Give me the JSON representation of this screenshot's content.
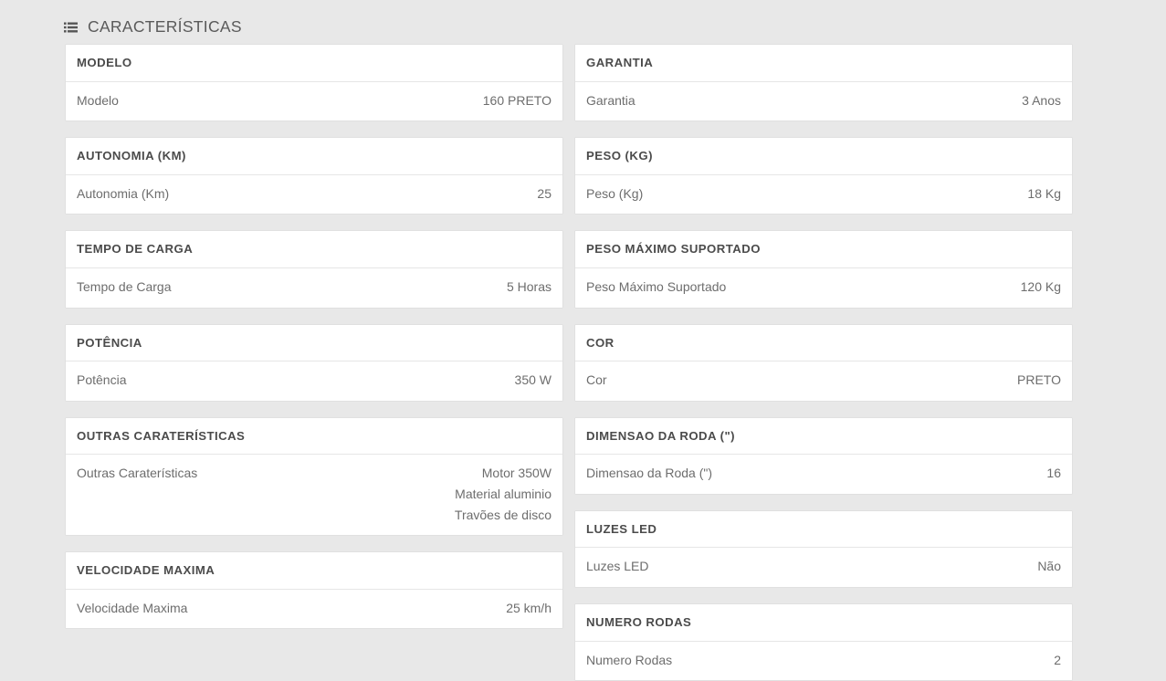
{
  "section": {
    "icon": "list-icon",
    "title": "CARACTERÍSTICAS"
  },
  "columns": {
    "left": [
      {
        "header": "MODELO",
        "label": "Modelo",
        "value": "160 PRETO"
      },
      {
        "header": "AUTONOMIA (KM)",
        "label": "Autonomia (Km)",
        "value": "25"
      },
      {
        "header": "TEMPO DE CARGA",
        "label": "Tempo de Carga",
        "value": "5 Horas"
      },
      {
        "header": "POTÊNCIA",
        "label": "Potência",
        "value": "350 W"
      },
      {
        "header": "OUTRAS CARATERÍSTICAS",
        "label": "Outras Caraterísticas",
        "value": "Motor 350W\nMaterial aluminio\nTravões de disco"
      },
      {
        "header": "VELOCIDADE MAXIMA",
        "label": "Velocidade Maxima",
        "value": "25 km/h"
      }
    ],
    "right": [
      {
        "header": "GARANTIA",
        "label": "Garantia",
        "value": "3 Anos"
      },
      {
        "header": "PESO (KG)",
        "label": "Peso (Kg)",
        "value": "18 Kg"
      },
      {
        "header": "PESO MÁXIMO SUPORTADO",
        "label": "Peso Máximo Suportado",
        "value": "120 Kg"
      },
      {
        "header": "COR",
        "label": "Cor",
        "value": "PRETO"
      },
      {
        "header": "DIMENSAO DA RODA (\")",
        "label": "Dimensao da Roda (\")",
        "value": "16"
      },
      {
        "header": "LUZES LED",
        "label": "Luzes LED",
        "value": "Não"
      },
      {
        "header": "NUMERO RODAS",
        "label": "Numero Rodas",
        "value": "2"
      }
    ]
  },
  "colors": {
    "page_background": "#e8e8e8",
    "card_background": "#ffffff",
    "card_border": "#e0e0e0",
    "header_text": "#4b4b4b",
    "body_text": "#6d6d6d"
  }
}
